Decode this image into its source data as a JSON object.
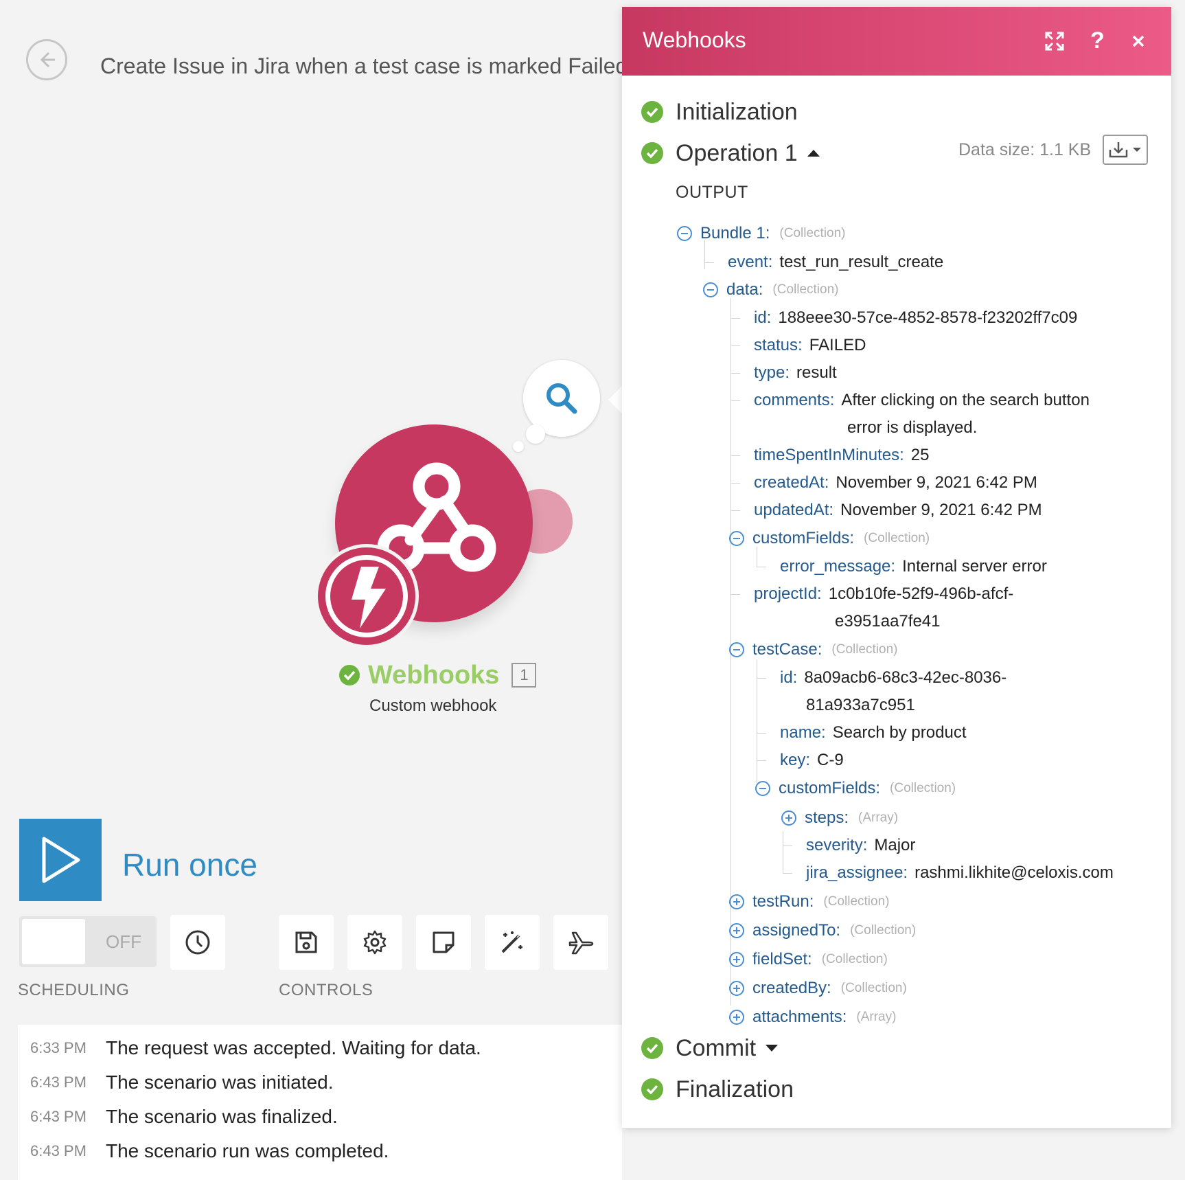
{
  "scenario": {
    "title": "Create Issue in Jira when a test case is marked Failed"
  },
  "module": {
    "name": "Webhooks",
    "count": "1",
    "subtitle": "Custom webhook",
    "color": "#c73861",
    "status_color": "#6cb33f"
  },
  "controls": {
    "run_label": "Run once",
    "toggle_state": "OFF",
    "scheduling_label": "SCHEDULING",
    "controls_label": "CONTROLS"
  },
  "log": [
    {
      "time": "6:33 PM",
      "message": "The request was accepted. Waiting for data."
    },
    {
      "time": "6:43 PM",
      "message": "The scenario was initiated."
    },
    {
      "time": "6:43 PM",
      "message": "The scenario was finalized."
    },
    {
      "time": "6:43 PM",
      "message": "The scenario run was completed."
    }
  ],
  "panel": {
    "title": "Webhooks",
    "stages": {
      "initialization": "Initialization",
      "operation": "Operation 1",
      "commit": "Commit",
      "finalization": "Finalization"
    },
    "data_size": "Data size: 1.1 KB",
    "output_label": "OUTPUT",
    "tree": {
      "bundle": {
        "key": "Bundle 1:",
        "type": "(Collection)"
      },
      "event": {
        "key": "event:",
        "value": "test_run_result_create"
      },
      "data": {
        "key": "data:",
        "type": "(Collection)"
      },
      "id": {
        "key": "id:",
        "value": "188eee30-57ce-4852-8578-f23202ff7c09"
      },
      "status": {
        "key": "status:",
        "value": "FAILED"
      },
      "type": {
        "key": "type:",
        "value": "result"
      },
      "comments": {
        "key": "comments:",
        "value": "After clicking on the search button",
        "value2": "error is displayed."
      },
      "timeSpent": {
        "key": "timeSpentInMinutes:",
        "value": "25"
      },
      "createdAt": {
        "key": "createdAt:",
        "value": "November 9, 2021 6:42 PM"
      },
      "updatedAt": {
        "key": "updatedAt:",
        "value": "November 9, 2021 6:42 PM"
      },
      "customFields": {
        "key": "customFields:",
        "type": "(Collection)"
      },
      "errorMessage": {
        "key": "error_message:",
        "value": "Internal server error"
      },
      "projectId": {
        "key": "projectId:",
        "value": "1c0b10fe-52f9-496b-afcf-",
        "value2": "e3951aa7fe41"
      },
      "testCase": {
        "key": "testCase:",
        "type": "(Collection)"
      },
      "tcId": {
        "key": "id:",
        "value": "8a09acb6-68c3-42ec-8036-",
        "value2": "81a933a7c951"
      },
      "tcName": {
        "key": "name:",
        "value": "Search by product"
      },
      "tcKey": {
        "key": "key:",
        "value": "C-9"
      },
      "tcCustomFields": {
        "key": "customFields:",
        "type": "(Collection)"
      },
      "steps": {
        "key": "steps:",
        "type": "(Array)"
      },
      "severity": {
        "key": "severity:",
        "value": "Major"
      },
      "jiraAssignee": {
        "key": "jira_assignee:",
        "value": "rashmi.likhite@celoxis.com"
      },
      "testRun": {
        "key": "testRun:",
        "type": "(Collection)"
      },
      "assignedTo": {
        "key": "assignedTo:",
        "type": "(Collection)"
      },
      "fieldSet": {
        "key": "fieldSet:",
        "type": "(Collection)"
      },
      "createdBy": {
        "key": "createdBy:",
        "type": "(Collection)"
      },
      "attachments": {
        "key": "attachments:",
        "type": "(Array)"
      }
    }
  }
}
